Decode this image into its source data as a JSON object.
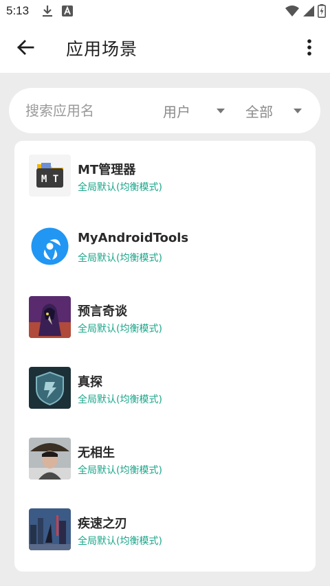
{
  "status_bar": {
    "time": "5:13"
  },
  "app_bar": {
    "title": "应用场景"
  },
  "filter": {
    "search_placeholder": "搜索应用名",
    "user_filter": "用户",
    "scope_filter": "全部"
  },
  "apps": [
    {
      "name": "MT管理器",
      "mode": "全局默认(均衡模式)",
      "icon": "mt-manager-icon"
    },
    {
      "name": "MyAndroidTools",
      "mode": "全局默认(均衡模式)",
      "icon": "myandroidtools-icon"
    },
    {
      "name": "预言奇谈",
      "mode": "全局默认(均衡模式)",
      "icon": "crow-wizard-icon"
    },
    {
      "name": "真探",
      "mode": "全局默认(均衡模式)",
      "icon": "detective-badge-icon"
    },
    {
      "name": "无相生",
      "mode": "全局默认(均衡模式)",
      "icon": "hat-warrior-icon"
    },
    {
      "name": "疾速之刃",
      "mode": "全局默认(均衡模式)",
      "icon": "city-blade-icon"
    }
  ],
  "colors": {
    "accent_text": "#1aa68a",
    "background": "#ececec"
  }
}
